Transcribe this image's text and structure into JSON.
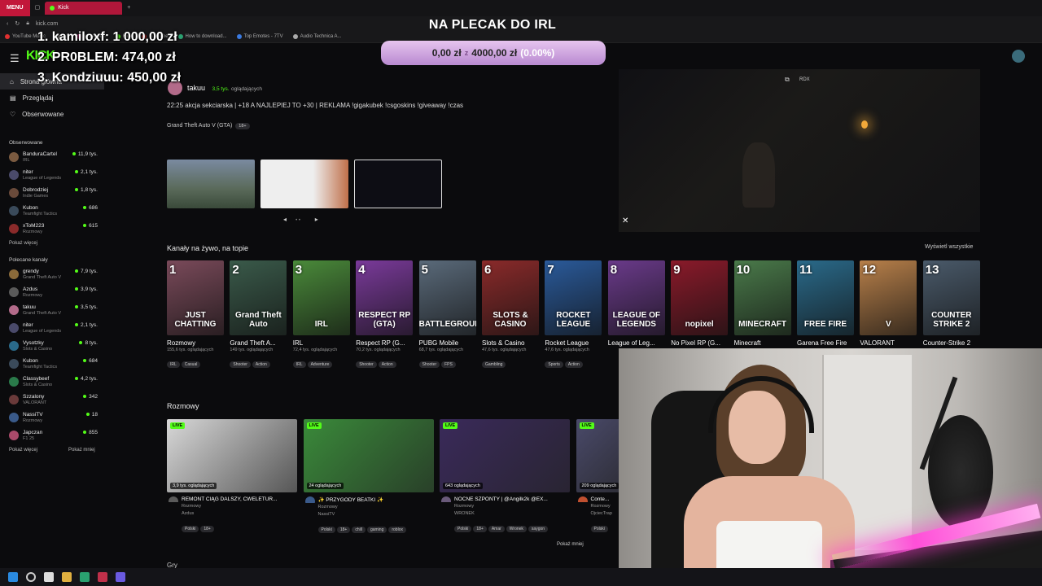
{
  "browser": {
    "menu_label": "MENU",
    "tab_title": "Kick",
    "url": "kick.com",
    "bookmarks": [
      "YouTube Music",
      "...",
      "Instagram",
      "Kick",
      "YouTube",
      "How to download...",
      "Top Emotes - 7TV",
      "Audio Technica A..."
    ]
  },
  "overlay": {
    "donors": [
      {
        "rank_name": "1. kamiloxf:",
        "amount": "1 000,00 zł"
      },
      {
        "rank_name": "2. PR0BLEM:",
        "amount": "474,00 zł"
      },
      {
        "rank_name": "3. Kondziuuu:",
        "amount": "450,00 zł"
      }
    ],
    "goal_title": "NA PLECAK DO IRL",
    "goal_current": "0,00 zł",
    "goal_separator": "z",
    "goal_target": "4000,00 zł",
    "goal_percent": "(0.00%)"
  },
  "kick": {
    "logo": "KICK",
    "nav": [
      {
        "label": "Strona główna",
        "icon": "home-icon"
      },
      {
        "label": "Przeglądaj",
        "icon": "browse-icon"
      },
      {
        "label": "Obserwowane",
        "icon": "heart-icon"
      }
    ],
    "followed_heading": "Obserwowane",
    "followed": [
      {
        "name": "BanduraCartel",
        "cat": "IRL",
        "viewers": "11,9 tys.",
        "color": "#7a5a40"
      },
      {
        "name": "niter",
        "cat": "League of Legends",
        "viewers": "2,1 tys.",
        "color": "#4a4a6a"
      },
      {
        "name": "Dobrodziej",
        "cat": "Indie Games",
        "viewers": "1,8 tys.",
        "color": "#6a4a3a"
      },
      {
        "name": "Kubon",
        "cat": "Teamfight Tactics",
        "viewers": "686",
        "color": "#3a4a5a"
      },
      {
        "name": "xToM223",
        "cat": "Rozmowy",
        "viewers": "615",
        "color": "#8a2a2a"
      }
    ],
    "followed_more": "Pokaż więcej",
    "recommended_heading": "Polecane kanały",
    "recommended": [
      {
        "name": "grendy",
        "cat": "Grand Theft Auto V",
        "viewers": "7,9 tys.",
        "color": "#8a6a3a"
      },
      {
        "name": "Azdus",
        "cat": "Rozmowy",
        "viewers": "3,9 tys.",
        "color": "#5a5a5a"
      },
      {
        "name": "takuu",
        "cat": "Grand Theft Auto V",
        "viewers": "3,5 tys.",
        "color": "#b36b8a"
      },
      {
        "name": "niter",
        "cat": "League of Legends",
        "viewers": "2,1 tys.",
        "color": "#4a4a6a"
      },
      {
        "name": "Vysotzky",
        "cat": "Slots & Casino",
        "viewers": "8 tys.",
        "color": "#2a6a8a"
      },
      {
        "name": "Kubon",
        "cat": "Teamfight Tactics",
        "viewers": "684",
        "color": "#3a4a5a"
      },
      {
        "name": "Classybeef",
        "cat": "Slots & Casino",
        "viewers": "4,2 tys.",
        "color": "#2a7a4a"
      },
      {
        "name": "Szzalony",
        "cat": "VALORANT",
        "viewers": "342",
        "color": "#6a3a3a"
      },
      {
        "name": "NassiTV",
        "cat": "Rozmowy",
        "viewers": "18",
        "color": "#3a5a8a"
      },
      {
        "name": "Japczan",
        "cat": "F1 25",
        "viewers": "855",
        "color": "#aa4a6a"
      }
    ],
    "rec_more": "Pokaż więcej",
    "rec_less": "Pokaż mniej"
  },
  "hero": {
    "user": "takuu",
    "viewers": "3,5 tys.",
    "viewers_label": "oglądających",
    "title": "22:25 akcja sekciarska | +18 A NAJLEPIEJ TO +30 | REKLAMA !gigakubek !csgoskins !giveaway !czas",
    "category": "Grand Theft Auto V (GTA)",
    "category_tag": "18+"
  },
  "live_categories": {
    "heading": "Kanały na żywo, na topie",
    "see_all": "Wyświetl wszystkie",
    "items": [
      {
        "num": "1",
        "logo": "JUST CHATTING",
        "name": "Rozmowy",
        "viewers": "155,6 tys. oglądających",
        "tags": [
          "IRL",
          "Casual"
        ],
        "color": "#7a4a5a"
      },
      {
        "num": "2",
        "logo": "Grand Theft Auto",
        "name": "Grand Theft A...",
        "viewers": "149 tys. oglądających",
        "tags": [
          "Shooter",
          "Action"
        ],
        "color": "#3a5a4a"
      },
      {
        "num": "3",
        "logo": "IRL",
        "name": "IRL",
        "viewers": "72,4 tys. oglądających",
        "tags": [
          "IRL",
          "Adventure"
        ],
        "color": "#4a8a3a"
      },
      {
        "num": "4",
        "logo": "RESPECT RP (GTA)",
        "name": "Respect RP (G...",
        "viewers": "70,2 tys. oglądających",
        "tags": [
          "Shooter",
          "Action"
        ],
        "color": "#7a3a9a"
      },
      {
        "num": "5",
        "logo": "BATTLEGROUNDS",
        "name": "PUBG Mobile",
        "viewers": "68,7 tys. oglądających",
        "tags": [
          "Shooter",
          "FPS"
        ],
        "color": "#5a6a7a"
      },
      {
        "num": "6",
        "logo": "SLOTS & CASINO",
        "name": "Slots & Casino",
        "viewers": "47,6 tys. oglądających",
        "tags": [
          "Gambling"
        ],
        "color": "#8a2a2a"
      },
      {
        "num": "7",
        "logo": "ROCKET LEAGUE",
        "name": "Rocket League",
        "viewers": "47,6 tys. oglądających",
        "tags": [
          "Sports",
          "Action"
        ],
        "color": "#2a5a9a"
      },
      {
        "num": "8",
        "logo": "LEAGUE OF LEGENDS",
        "name": "League of Leg...",
        "viewers": "",
        "tags": [],
        "color": "#6a3a8a"
      },
      {
        "num": "9",
        "logo": "nopixel",
        "name": "No Pixel RP (G...",
        "viewers": "",
        "tags": [],
        "color": "#8a1a2a"
      },
      {
        "num": "10",
        "logo": "MINECRAFT",
        "name": "Minecraft",
        "viewers": "",
        "tags": [],
        "color": "#4a7a4a"
      },
      {
        "num": "11",
        "logo": "FREE FIRE",
        "name": "Garena Free Fire",
        "viewers": "",
        "tags": [],
        "color": "#2a6a8a"
      },
      {
        "num": "12",
        "logo": "V",
        "name": "VALORANT",
        "viewers": "",
        "tags": [],
        "color": "#b8804a"
      },
      {
        "num": "13",
        "logo": "COUNTER STRIKE 2",
        "name": "Counter-Strike 2",
        "viewers": "",
        "tags": [],
        "color": "#4a5a6a"
      }
    ]
  },
  "rozmowy": {
    "heading": "Rozmowy",
    "live_label": "LIVE",
    "cards": [
      {
        "viewers": "3,9 tys. oglądających",
        "title": "REMONT CIĄG DALSZY, CWELETUR...",
        "cat": "Rozmowy",
        "user": "Azdus",
        "tags": [
          "Polski",
          "18+"
        ],
        "color": "#d8d8d8",
        "av": "#5a5a5a"
      },
      {
        "viewers": "24 oglądających",
        "title": "✨ PRZYGODY BEATKI ✨",
        "cat": "Rozmowy",
        "user": "NassiTV",
        "tags": [
          "Polski",
          "18+",
          "chill",
          "gaming",
          "roblox"
        ],
        "color": "#3a8a3a",
        "av": "#3a5a8a"
      },
      {
        "viewers": "643 oglądających",
        "title": "NOCNE SZPONTY | @Angilk2k @EX...",
        "cat": "Rozmowy",
        "user": "WRONEK",
        "tags": [
          "Polski",
          "18+",
          "Amar",
          "Wronek",
          "saygon"
        ],
        "color": "#3a2a5a",
        "av": "#6a5a7a"
      },
      {
        "viewers": "209 oglądających",
        "title": "Conte...",
        "cat": "Rozmowy",
        "user": "OjciecTrap",
        "tags": [
          "Polski"
        ],
        "color": "#4a4a6a",
        "av": "#c05030"
      }
    ],
    "show_less": "Pokaż mniej"
  },
  "footer_heading": "Gry"
}
